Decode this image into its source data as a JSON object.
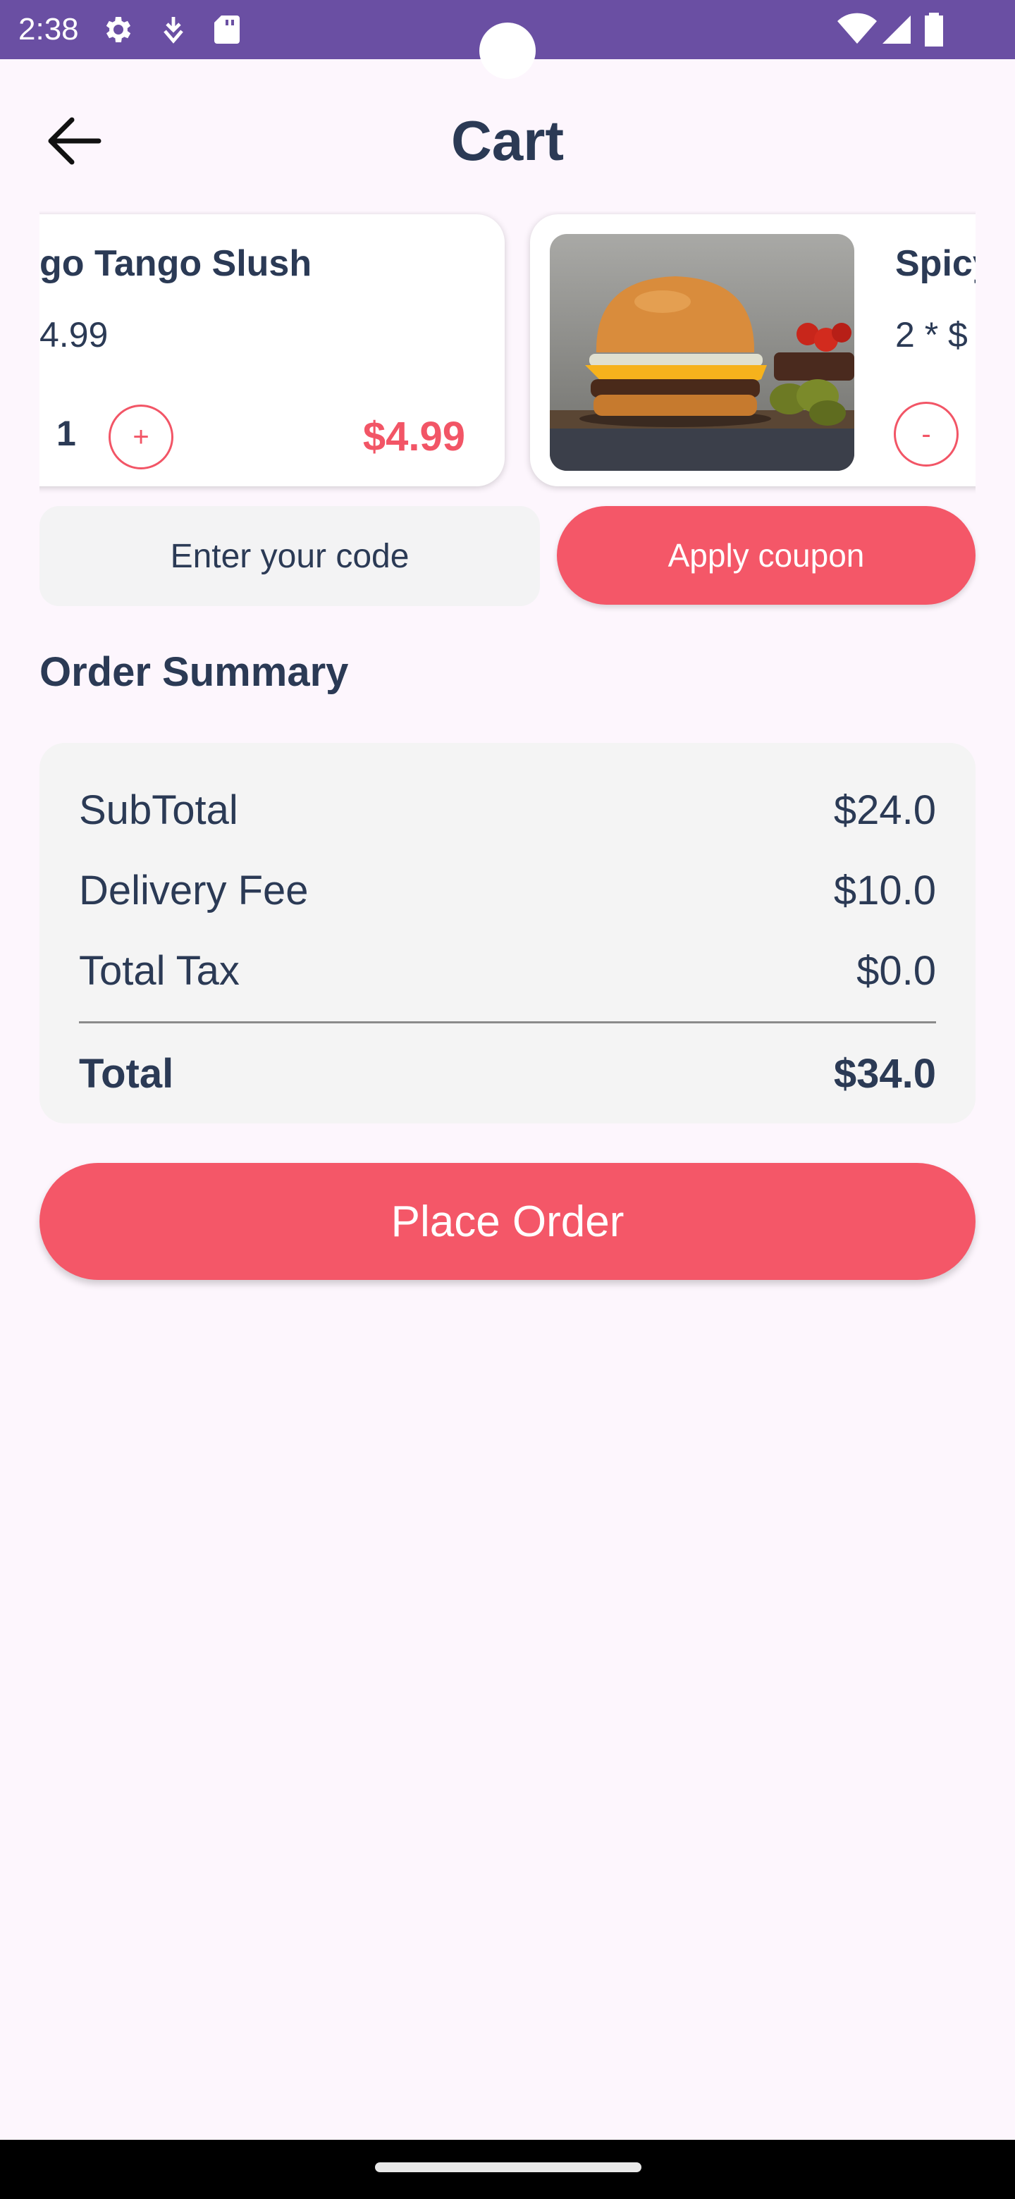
{
  "status_bar": {
    "time": "2:38",
    "icons": [
      "gear-icon",
      "download-icon",
      "sd-card-icon",
      "wifi-icon",
      "signal-icon",
      "battery-icon"
    ]
  },
  "header": {
    "title": "Cart",
    "back_icon": "arrow-left-icon"
  },
  "cart_items": [
    {
      "name": "go Tango Slush",
      "price_line": "4.99",
      "quantity": "1",
      "increment_label": "+",
      "total": "$4.99"
    },
    {
      "name": "Spicy",
      "price_line": "2 * $",
      "decrement_label": "-",
      "image": "burger-photo"
    }
  ],
  "coupon": {
    "placeholder": "Enter your code",
    "apply_label": "Apply coupon"
  },
  "summary": {
    "heading": "Order Summary",
    "rows": [
      {
        "label": "SubTotal",
        "value": "$24.0"
      },
      {
        "label": "Delivery Fee",
        "value": "$10.0"
      },
      {
        "label": "Total Tax",
        "value": "$0.0"
      }
    ],
    "total": {
      "label": "Total",
      "value": "$34.0"
    }
  },
  "place_order_label": "Place Order",
  "colors": {
    "accent": "#f45768",
    "text": "#2b3a55",
    "status_bar": "#6a4fa3",
    "background": "#fdf6fd"
  }
}
